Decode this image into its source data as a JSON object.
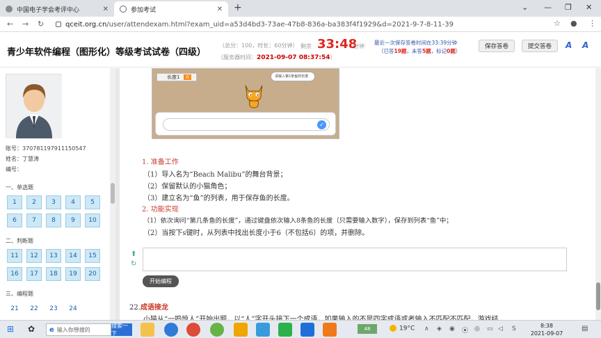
{
  "browser": {
    "tabs": [
      {
        "title": "中国电子学会考评中心",
        "active": false
      },
      {
        "title": "参加考试",
        "active": true
      }
    ],
    "new_tab": "+",
    "url_host": "qceit.org.cn",
    "url_path": "/user/attendexam.html?exam_uid=a53d4bd3-73ae-47b8-836a-ba383f4f1929&d=2021-9-7-8-11-39"
  },
  "exam_header": {
    "title": "青少年软件编程（图形化）等级考试试卷（四级）",
    "meta_total": "（总分：100，时长：60分钟）",
    "server_time_label": "（服务器时间：",
    "server_time": "2021-09-07  08:37:54",
    "server_time_close": "）",
    "remain_label": "剩余",
    "remain": "33:48",
    "remain_unit": "分钟",
    "save_info_1": "最近一次保存答卷时间在33:39分钟",
    "save_info_2_pre": "（已答",
    "answered": "19题",
    "save_info_2_mid": "，未答",
    "unanswered": "5题",
    "save_info_2_mid2": "，标记",
    "marked": "0题",
    "save_info_2_post": "）",
    "save_button": "保存答卷",
    "submit_button": "提交答卷"
  },
  "sidebar": {
    "account": "账号：370781197911150547",
    "name": "姓名：丁慧涛",
    "number": "编号：",
    "section1": "一、单选题",
    "single_choice": [
      "1",
      "2",
      "3",
      "4",
      "5",
      "6",
      "7",
      "8",
      "9",
      "10"
    ],
    "section2": "二、判断题",
    "true_false": [
      "11",
      "12",
      "13",
      "14",
      "15",
      "16",
      "17",
      "18",
      "19",
      "20"
    ],
    "section3": "三、编程题",
    "programming": [
      "21",
      "22",
      "23",
      "24"
    ]
  },
  "stage": {
    "var_name": "长度1",
    "var_value": "0",
    "bubble": "请输入第1条鱼的长度"
  },
  "content": {
    "h1": "1. 准备工作",
    "l1": "（1）导入名为“Beach Malibu”的舞台背景；",
    "l2": "（2）保留默认的小猫角色；",
    "l3": "（3）建立名为“鱼”的列表，用于保存鱼的长度。",
    "h2": "2. 功能实现",
    "l4": "（1）依次询问“第几条鱼的长度”，通过键盘依次输入8条鱼的长度（只需要输入数字），保存到列表“鱼”中；",
    "l5": "（2）当按下s键时，从列表中找出长度小于6（不包括6）的项，并删除。",
    "start_button": "开始编程",
    "q22_num": "22.",
    "q22_title": "成语接龙",
    "q22_text": "小猫从“一鸣惊人”开始出题，以“人”字开头接下一个成语，如果输入的不是四字成语或者输入不匹配不匹配，游戏结"
  },
  "taskbar": {
    "search_placeholder": "输入你想搜的",
    "search_button": "搜索一下",
    "battery": "48",
    "temperature": "19°C",
    "time": "8:38",
    "date": "2021-09-07"
  },
  "colors": {
    "accent_red": "#e0261f",
    "link_blue": "#3355aa",
    "qbtn_bg": "#cde8f6"
  }
}
